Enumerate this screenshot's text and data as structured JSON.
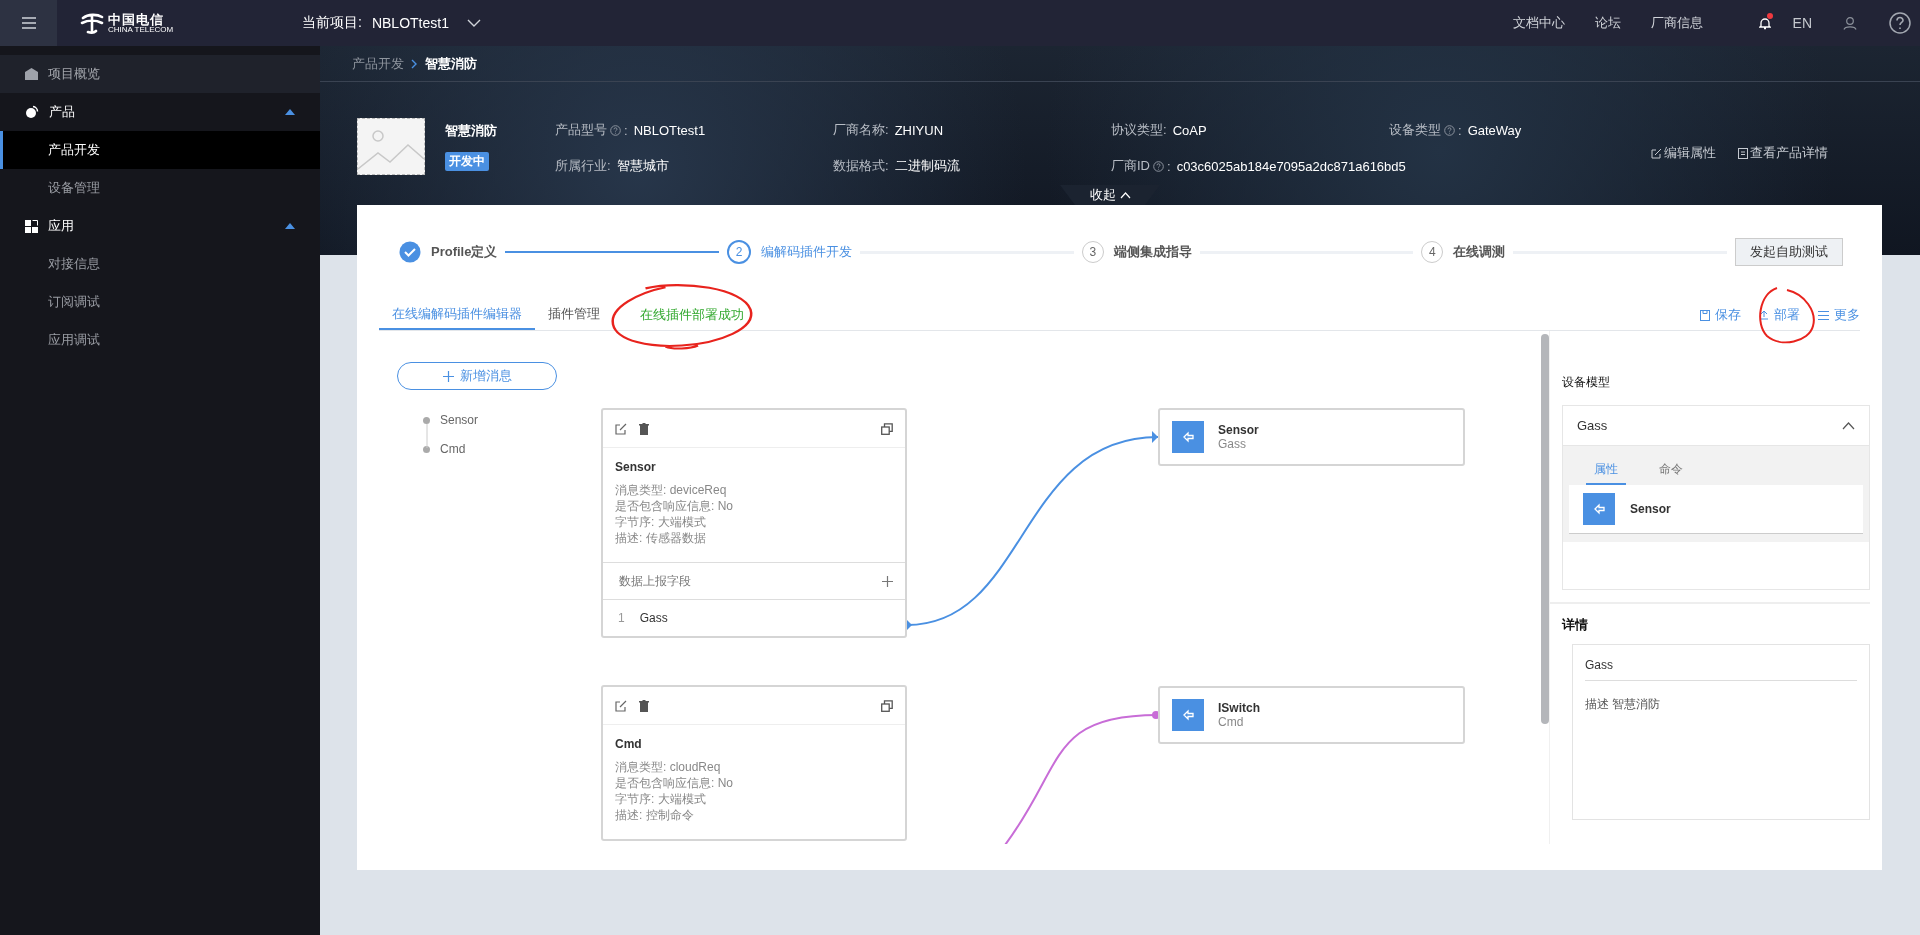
{
  "topbar": {
    "logo": {
      "name": "中国电信",
      "sub": "CHINA TELECOM"
    },
    "project_label": "当前项目:",
    "project": "NBLOTtest1",
    "links": [
      "文档中心",
      "论坛",
      "厂商信息"
    ],
    "notification_dot": true,
    "language": "EN"
  },
  "sidebar": {
    "items": [
      {
        "label": "项目概览",
        "selected": false
      },
      {
        "label": "产品",
        "expanded": true,
        "children": [
          {
            "label": "产品开发",
            "selected": true
          },
          {
            "label": "设备管理",
            "selected": false
          }
        ]
      },
      {
        "label": "应用",
        "expanded": true,
        "children": [
          {
            "label": "对接信息",
            "selected": false
          },
          {
            "label": "订阅调试",
            "selected": false
          },
          {
            "label": "应用调试",
            "selected": false
          }
        ]
      }
    ]
  },
  "breadcrumb": [
    "产品开发",
    "智慧消防"
  ],
  "product": {
    "name": "智慧消防",
    "status": "开发中",
    "fields": [
      {
        "label": "产品型号",
        "help": true,
        "suffix": ":",
        "value": "NBLOTtest1"
      },
      {
        "label": "厂商名称:",
        "help": false,
        "value": "ZHIYUN"
      },
      {
        "label": "协议类型:",
        "help": false,
        "value": "CoAP"
      },
      {
        "label": "设备类型",
        "help": true,
        "suffix": ":",
        "value": "GateWay"
      },
      {
        "label": "所属行业:",
        "help": false,
        "value": "智慧城市"
      },
      {
        "label": "数据格式:",
        "help": false,
        "value": "二进制码流"
      },
      {
        "label": "厂商ID",
        "help": true,
        "suffix": ":",
        "value": "c03c6025ab184e7095a2dc871a616bd5"
      }
    ],
    "actions": [
      "编辑属性",
      "查看产品详情"
    ],
    "collapse": "收起"
  },
  "steps": [
    {
      "label": "Profile定义",
      "done": true,
      "selected": false
    },
    {
      "number": "2",
      "label": "编解码插件开发",
      "done": false,
      "selected": true
    },
    {
      "number": "3",
      "label": "端侧集成指导",
      "done": false,
      "selected": false
    },
    {
      "number": "4",
      "label": "在线调测",
      "done": false,
      "selected": false
    }
  ],
  "test_button": "发起自助测试",
  "tabs": [
    {
      "label": "在线编解码插件编辑器",
      "selected": true
    },
    {
      "label": "插件管理",
      "selected": false
    }
  ],
  "status_message": "在线插件部署成功",
  "toolbar": [
    "保存",
    "部署",
    "更多"
  ],
  "editor": {
    "add_button": "新增消息",
    "messages": [
      "Sensor",
      "Cmd"
    ],
    "cards": [
      {
        "title": "Sensor",
        "lines": [
          "消息类型: deviceReq",
          "是否包含响应信息: No",
          "字节序: 大端模式",
          "描述: 传感器数据"
        ],
        "fields_header": "数据上报字段",
        "fields": [
          {
            "index": "1",
            "name": "Gass"
          }
        ]
      },
      {
        "title": "Cmd",
        "lines": [
          "消息类型: cloudReq",
          "是否包含响应信息: No",
          "字节序: 大端模式",
          "描述: 控制命令"
        ]
      }
    ],
    "targets": [
      {
        "title": "Sensor",
        "sub": "Gass",
        "color": "#4a90e2"
      },
      {
        "title": "ISwitch",
        "sub": "Cmd",
        "color": "#c86dd7"
      }
    ]
  },
  "model_panel": {
    "title": "设备模型",
    "service": "Gass",
    "expanded": true,
    "tabs": [
      {
        "label": "属性",
        "selected": true
      },
      {
        "label": "命令",
        "selected": false
      }
    ],
    "items": [
      "Sensor"
    ],
    "details_title": "详情",
    "details": {
      "name": "Gass",
      "description": "描述 智慧消防"
    }
  }
}
